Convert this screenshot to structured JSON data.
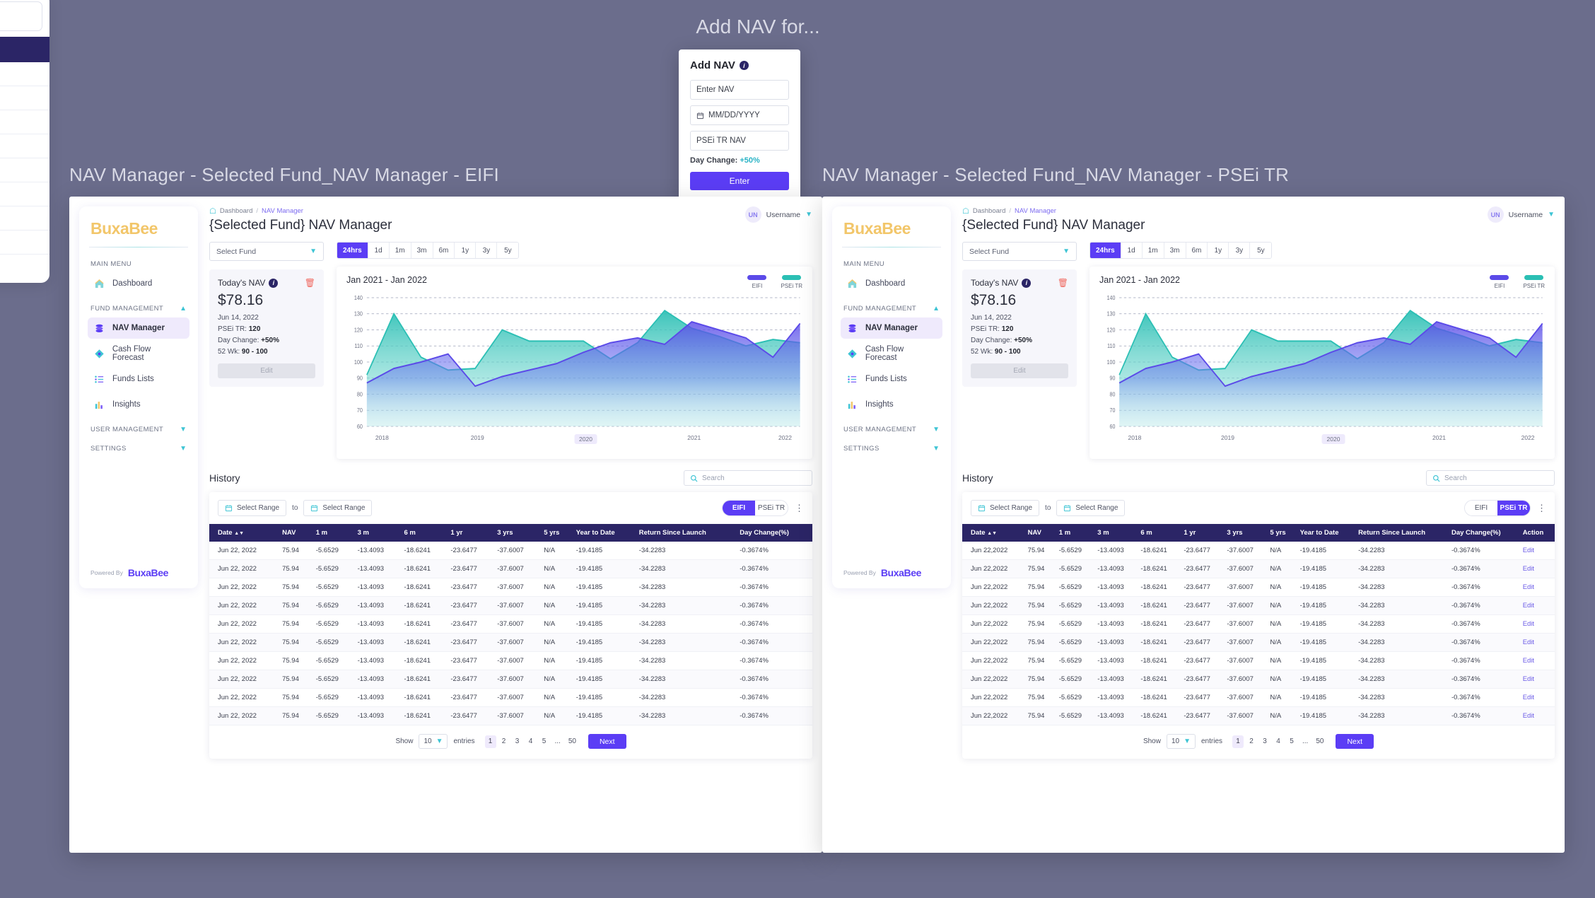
{
  "panel_titles": {
    "left": "NAV Manager - Selected Fund_NAV Manager - EIFI",
    "right": "NAV Manager - Selected Fund_NAV Manager - PSEi TR"
  },
  "modal": {
    "caption": "Add NAV for...",
    "title": "Add NAV",
    "info_icon": "info-icon",
    "nav_placeholder": "Enter NAV",
    "date_placeholder": "MM/DD/YYYY",
    "date_icon": "calendar-icon",
    "psei_placeholder": "PSEi TR NAV",
    "day_change_label": "Day Change:",
    "day_change_value": "+50%",
    "enter_label": "Enter"
  },
  "sidebar": {
    "logo": "BuxaBee",
    "sections": [
      {
        "caption": "MAIN MENU",
        "collapsible": false
      },
      {
        "caption": "FUND MANAGEMENT",
        "collapsible": true,
        "chevron": "chevron-up-icon"
      },
      {
        "caption": "USER MANAGEMENT",
        "collapsible": true,
        "chevron": "chevron-down-icon"
      },
      {
        "caption": "SETTINGS",
        "collapsible": true,
        "chevron": "chevron-down-icon"
      }
    ],
    "items": [
      {
        "label": "Dashboard",
        "icon": "home-icon",
        "active": false
      },
      {
        "label": "NAV Manager",
        "icon": "database-icon",
        "active": true
      },
      {
        "label": "Cash Flow Forecast",
        "icon": "diamond-icon",
        "active": false
      },
      {
        "label": "Funds Lists",
        "icon": "list-icon",
        "active": false
      },
      {
        "label": "Insights",
        "icon": "bar-chart-icon",
        "active": false
      }
    ],
    "footer_prefix": "Powered By",
    "footer_logo": "BuxaBee"
  },
  "header": {
    "breadcrumb_home": "Dashboard",
    "breadcrumb_sep": "/",
    "breadcrumb_current": "NAV Manager",
    "title": "{Selected Fund} NAV Manager",
    "avatar_initials": "UN",
    "username": "Username",
    "user_chevron": "chevron-down-icon"
  },
  "fund_select": {
    "value": "Select Fund",
    "chevron": "chevron-down-icon"
  },
  "nav_card": {
    "title": "Today's NAV",
    "info_icon": "info-icon",
    "delete_icon": "trash-icon",
    "amount": "$78.16",
    "date": "Jun 14, 2022",
    "psei_label": "PSEi TR:",
    "psei_value": "120",
    "day_change_label": "Day Change:",
    "day_change_value": "+50%",
    "wk52_label": "52 Wk:",
    "wk52_value": "90 - 100",
    "edit_label": "Edit"
  },
  "range_tabs": [
    {
      "label": "24hrs",
      "active": true
    },
    {
      "label": "1d",
      "active": false
    },
    {
      "label": "1m",
      "active": false
    },
    {
      "label": "3m",
      "active": false
    },
    {
      "label": "6m",
      "active": false
    },
    {
      "label": "1y",
      "active": false
    },
    {
      "label": "3y",
      "active": false
    },
    {
      "label": "5y",
      "active": false
    }
  ],
  "chart_data": {
    "type": "area",
    "title": "Jan 2021 - Jan 2022",
    "xlabel": "",
    "ylabel": "",
    "ylim": [
      60,
      140
    ],
    "yticks": [
      60,
      70,
      80,
      90,
      100,
      110,
      120,
      130,
      140
    ],
    "grid": true,
    "legend_position": "top-right",
    "xticks": [
      "2018",
      "2019",
      "2020",
      "2021",
      "2022"
    ],
    "highlighted_xtick": "2020",
    "x": [
      0,
      1,
      2,
      3,
      4,
      5,
      6,
      7,
      8,
      9,
      10,
      11,
      12,
      13,
      14,
      15,
      16
    ],
    "series": [
      {
        "name": "EIFI",
        "color": "#5b4ae8",
        "values": [
          87,
          96,
          100,
          105,
          85,
          91,
          95,
          99,
          106,
          112,
          115,
          111,
          125,
          120,
          115,
          103,
          124
        ]
      },
      {
        "name": "PSEi TR",
        "color": "#2bbfb4",
        "values": [
          92,
          130,
          103,
          95,
          96,
          120,
          113,
          113,
          113,
          102,
          112,
          132,
          121,
          116,
          110,
          114,
          112
        ]
      }
    ]
  },
  "history": {
    "title": "History",
    "search_placeholder": "Search",
    "search_icon": "search-icon",
    "range_from_label": "Select Range",
    "range_to_word": "to",
    "range_to_label": "Select Range",
    "calendar_icon": "calendar-icon",
    "kebab_icon": "more-vertical-icon",
    "toggles_left": [
      {
        "label": "EIFI",
        "active": true
      },
      {
        "label": "PSEi TR",
        "active": false
      }
    ],
    "toggles_right": [
      {
        "label": "EIFI",
        "active": false
      },
      {
        "label": "PSEi TR",
        "active": true
      }
    ],
    "columns_left": [
      "Date",
      "NAV",
      "1 m",
      "3 m",
      "6 m",
      "1 yr",
      "3 yrs",
      "5 yrs",
      "Year to Date",
      "Return Since Launch",
      "Day Change(%)"
    ],
    "columns_right": [
      "Date",
      "NAV",
      "1 m",
      "3 m",
      "6 m",
      "1 yr",
      "3 yrs",
      "5 yrs",
      "Year to Date",
      "Return Since Launch",
      "Day Change(%)",
      "Action"
    ],
    "sort_icon": "sort-icon",
    "row_left": [
      "Jun 22, 2022",
      "75.94",
      "-5.6529",
      "-13.4093",
      "-18.6241",
      "-23.6477",
      "-37.6007",
      "N/A",
      "-19.4185",
      "-34.2283",
      "-0.3674%"
    ],
    "row_right": [
      "Jun 22,2022",
      "75.94",
      "-5.6529",
      "-13.4093",
      "-18.6241",
      "-23.6477",
      "-37.6007",
      "N/A",
      "-19.4185",
      "-34.2283",
      "-0.3674%"
    ],
    "action_label": "Edit",
    "row_count_left": 10,
    "row_count_right": 10
  },
  "pager": {
    "show_label": "Show",
    "page_size": "10",
    "entries_label": "entries",
    "chevron": "chevron-down-icon",
    "pages": [
      "1",
      "2",
      "3",
      "4",
      "5",
      "...",
      "50"
    ],
    "active_page": "1",
    "next_label": "Next"
  },
  "colors": {
    "background": "#6b6d8c",
    "accent": "#5b3df5",
    "table_header": "#2b2566",
    "teal": "#3ec4d4",
    "logo_gold": "#f2c66a",
    "danger": "#f0685f"
  }
}
